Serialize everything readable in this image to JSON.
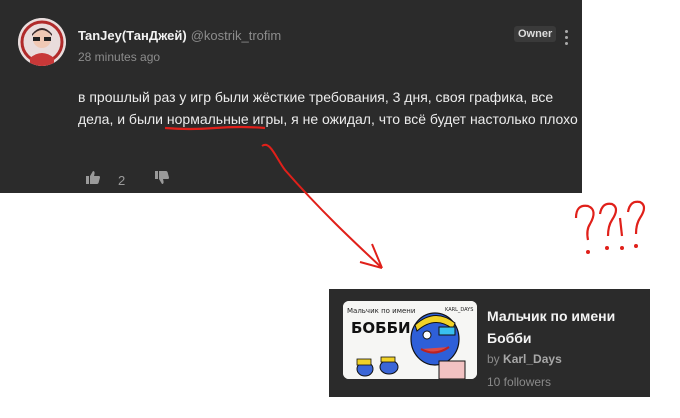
{
  "comment": {
    "author_name": "TanJey(ТанДжей)",
    "author_handle": "@kostrik_trofim",
    "timestamp": "28 minutes ago",
    "badge": "Owner",
    "text_before": "в прошлый раз у игр были жёсткие требования, 3 дня, своя графика, все дела, и были ",
    "text_highlight": "нормальные игры",
    "text_after": ", я не ожидал, что всё будет настолько плохо",
    "like_count": "2",
    "icons": [
      "thumbs-up-icon",
      "thumbs-down-icon",
      "kebab-menu-icon"
    ]
  },
  "annotation": {
    "scribble_text": "??!?",
    "color": "#e0201a"
  },
  "game_card": {
    "title": "Мальчик по имени Бобби",
    "author_prefix": "by",
    "author": "Karl_Days",
    "followers": "10 followers",
    "thumbnail": {
      "header_text": "Мальчик по имени",
      "big_text": "БОББИ",
      "corner_text": "KARL_DAYS"
    }
  }
}
